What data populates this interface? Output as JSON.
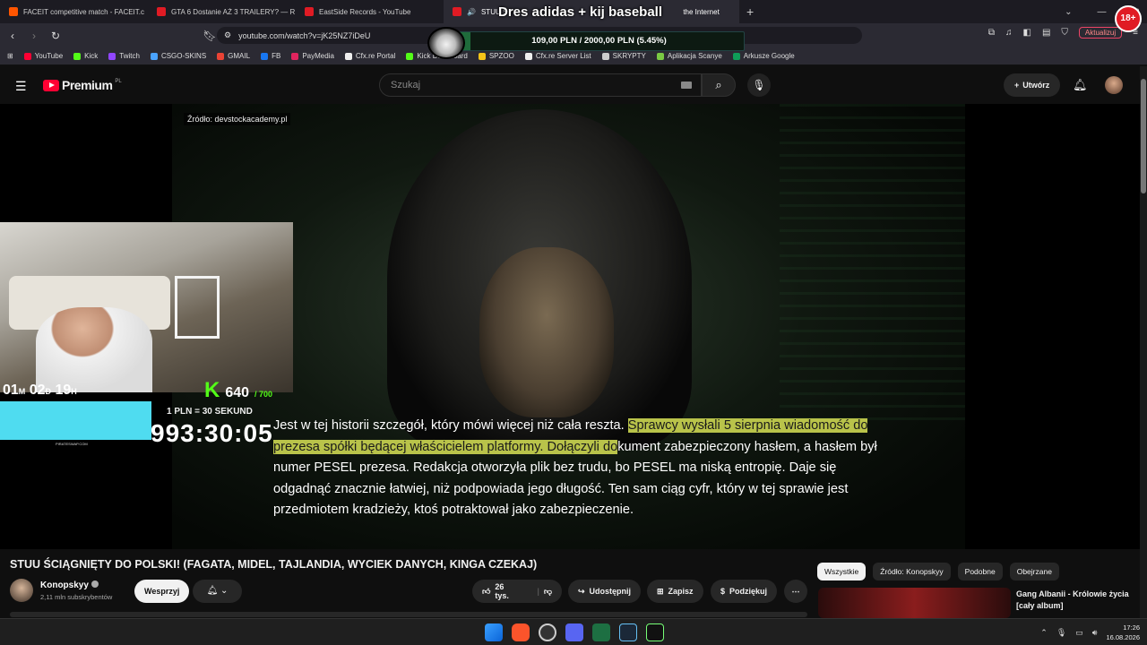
{
  "browser": {
    "tabs": [
      {
        "title": "FACEIT competitive match - FACEIT.c",
        "color": "#ff5500"
      },
      {
        "title": "GTA 6 Dostanie AŻ 3 TRAILERY? — R",
        "color": "#e01b24"
      },
      {
        "title": "EastSide Records - YouTube",
        "color": "#e01b24"
      },
      {
        "title": "STUU Ś",
        "color": "#e01b24",
        "active": true,
        "suffix": "the Internet"
      }
    ],
    "new_tab": "+",
    "url": "youtube.com/watch?v=jK25NZ7iDeU",
    "update_button": "Aktualizuj",
    "bookmarks": [
      {
        "label": "YouTube",
        "color": "#ff0033"
      },
      {
        "label": "Kick",
        "color": "#53fc18"
      },
      {
        "label": "Twitch",
        "color": "#9146ff"
      },
      {
        "label": "CSGO-SKINS",
        "color": "#4aa3ff"
      },
      {
        "label": "GMAIL",
        "color": "#ea4335"
      },
      {
        "label": "FB",
        "color": "#1877f2"
      },
      {
        "label": "PayMedia",
        "color": "#e0245e"
      },
      {
        "label": "Cfx.re Portal",
        "color": "#eeeeee"
      },
      {
        "label": "Kick Dashboard",
        "color": "#53fc18"
      },
      {
        "label": "SPZOO",
        "color": "#f5c518"
      },
      {
        "label": "Cfx.re Server List",
        "color": "#eeeeee"
      },
      {
        "label": "SKRYPTY",
        "color": "#cccccc"
      },
      {
        "label": "Aplikacja Scanye",
        "color": "#7ac943"
      },
      {
        "label": "Arkusze Google",
        "color": "#0f9d58"
      }
    ]
  },
  "youtube": {
    "logo_text": "Premium",
    "logo_sup": "PL",
    "search_placeholder": "Szukaj",
    "create_label": "Utwórz"
  },
  "overlay": {
    "source_label": "Źródło:  devstockacademy.pl",
    "goal_title": "Dres adidas + kij baseball",
    "goal_text": "109,00 PLN / 2000,00 PLN  (5.45%)",
    "goal_progress": 0.0545,
    "badge": "18+",
    "timer_days": "01",
    "timer_days_unit": "M",
    "timer_d": "02",
    "timer_d_unit": "D",
    "timer_h": "19",
    "timer_h_unit": "H",
    "kick_logo": "K",
    "counter": "640",
    "counter_max": "/ 700",
    "rate": "1 PLN = 30 SEKUND",
    "countdown": "993:30:05",
    "cyan_caption": "PIRATESWAP.COM"
  },
  "subtitles": {
    "part1": "Jest w tej historii szczegół, który mówi więcej niż cała reszta. ",
    "hl1": "Sprawcy wysłali 5 sierpnia wiadomość do prezesa spółki będącej właścicielem platformy. Dołączyli do",
    "part2": "kument zabezpieczony hasłem, a hasłem był numer PESEL prezesa. Redakcja otworzyła plik bez trudu, bo PESEL ma niską entropię. Daje się odgadnąć znacznie łatwiej, niż podpowiada jego długość. Ten sam ciąg cyfr, który w tej sprawie jest przedmiotem kradzieży, ktoś potraktował jako zabezpieczenie."
  },
  "video": {
    "title": "STUU ŚCIĄGNIĘTY DO POLSKI! (FAGATA, MIDEL, TAJLANDIA, WYCIEK DANYCH, KINGA CZEKAJ)",
    "channel": "Konopskyy",
    "subscribers": "2,11 mln subskrybentów",
    "subscribe": "Wesprzyj",
    "likes": "26 tys.",
    "share": "Udostępnij",
    "save": "Zapisz",
    "thanks": "Podziękuj",
    "more": "⋯"
  },
  "sidebar": {
    "chips": [
      "Wszystkie",
      "Źródło: Konopskyy",
      "Podobne",
      "Obejrzane"
    ],
    "rec_title": "Gang Albanii - Królowie życia [cały album]"
  },
  "taskbar": {
    "time": "17:26",
    "date": "16.08.2026"
  }
}
